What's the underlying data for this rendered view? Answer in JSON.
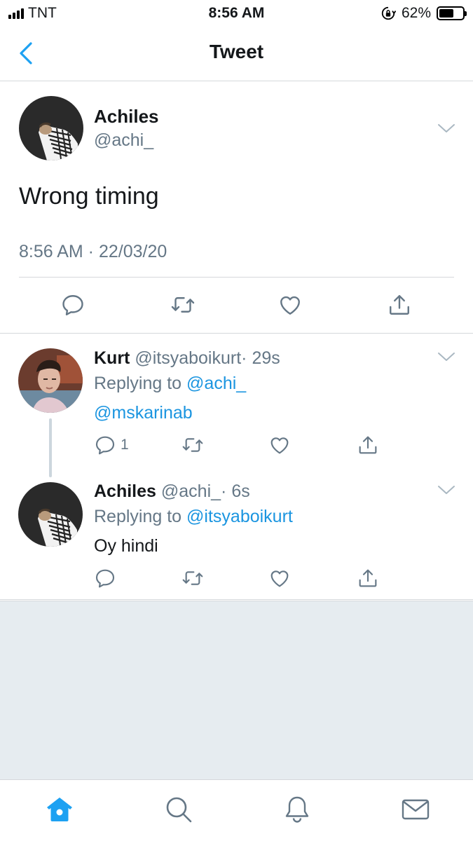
{
  "status_bar": {
    "carrier": "TNT",
    "time": "8:56 AM",
    "battery": "62%",
    "battery_level": 0.62
  },
  "header": {
    "title": "Tweet",
    "back_icon": "chevron-left-icon",
    "accent_color": "#1da1f2"
  },
  "main_tweet": {
    "author_name": "Achiles",
    "author_handle": "@achi_",
    "text": "Wrong timing",
    "timestamp": "8:56 AM · 22/03/20"
  },
  "replies": [
    {
      "author_name": "Kurt",
      "author_handle": "@itsyaboikurt",
      "age": "· 29s",
      "replying_label": "Replying to",
      "replying_to": "@achi_",
      "text": "@mskarinab",
      "reply_count": "1"
    },
    {
      "author_name": "Achiles",
      "author_handle": "@achi_",
      "age": "· 6s",
      "replying_label": "Replying to",
      "replying_to": "@itsyaboikurt",
      "text": "Oy hindi",
      "reply_count": ""
    }
  ],
  "tabbar": {
    "items": [
      "home-icon",
      "search-icon",
      "notifications-icon",
      "messages-icon"
    ],
    "active_color": "#1da1f2"
  }
}
